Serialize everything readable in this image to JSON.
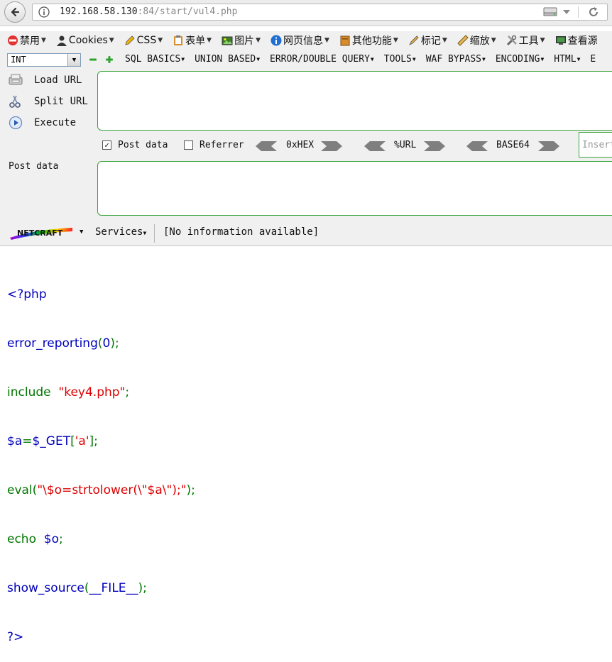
{
  "urlbar": {
    "host": "192.168.58.130",
    "path": ":84/start/vul4.php"
  },
  "menubar": {
    "items": [
      {
        "label": "禁用",
        "icon": "forbidden-icon"
      },
      {
        "label": "Cookies",
        "icon": "person-icon"
      },
      {
        "label": "CSS",
        "icon": "pencil-icon"
      },
      {
        "label": "表单",
        "icon": "clipboard-icon"
      },
      {
        "label": "图片",
        "icon": "image-icon"
      },
      {
        "label": "网页信息",
        "icon": "info-icon"
      },
      {
        "label": "其他功能",
        "icon": "box-icon"
      },
      {
        "label": "标记",
        "icon": "highlighter-icon"
      },
      {
        "label": "缩放",
        "icon": "ruler-icon"
      },
      {
        "label": "工具",
        "icon": "tools-icon"
      },
      {
        "label": "查看源",
        "icon": "monitor-icon"
      }
    ]
  },
  "hackbar": {
    "select_value": "INT",
    "menus": [
      "SQL BASICS",
      "UNION BASED",
      "ERROR/DOUBLE QUERY",
      "TOOLS",
      "WAF BYPASS",
      "ENCODING",
      "HTML",
      "E"
    ],
    "load_url": "Load URL",
    "split_url": "Split URL",
    "execute": "Execute",
    "post_data_checkbox": "Post data",
    "referrer_checkbox": "Referrer",
    "enc_hex": "0xHEX",
    "enc_url": "%URL",
    "enc_base64": "BASE64",
    "insert_placeholder": "Insert",
    "post_data_label": "Post data"
  },
  "netcraft": {
    "services": "Services",
    "info": "[No information available]"
  },
  "source": {
    "line1": "<?php",
    "line2_fn": "error_reporting",
    "line2_open": "(",
    "line2_arg": "0",
    "line2_close": ");",
    "line3_kw": "include",
    "line3_str": "\"key4.php\"",
    "line3_end": ";",
    "line4_var": "$a",
    "line4_eq": "=",
    "line4_get": "$_GET",
    "line4_br": "[",
    "line4_key": "'a'",
    "line4_end": "];",
    "line5_fn": "eval",
    "line5_open": "(",
    "line5_str": "\"\\$o=strtolower(\\\"$a\\\");\"",
    "line5_end": ");",
    "line6_kw": "echo",
    "line6_var": "$o",
    "line6_end": ";",
    "line7_fn": "show_source",
    "line7_open": "(",
    "line7_const": "__FILE__",
    "line7_close": ");",
    "line8": "?>"
  }
}
